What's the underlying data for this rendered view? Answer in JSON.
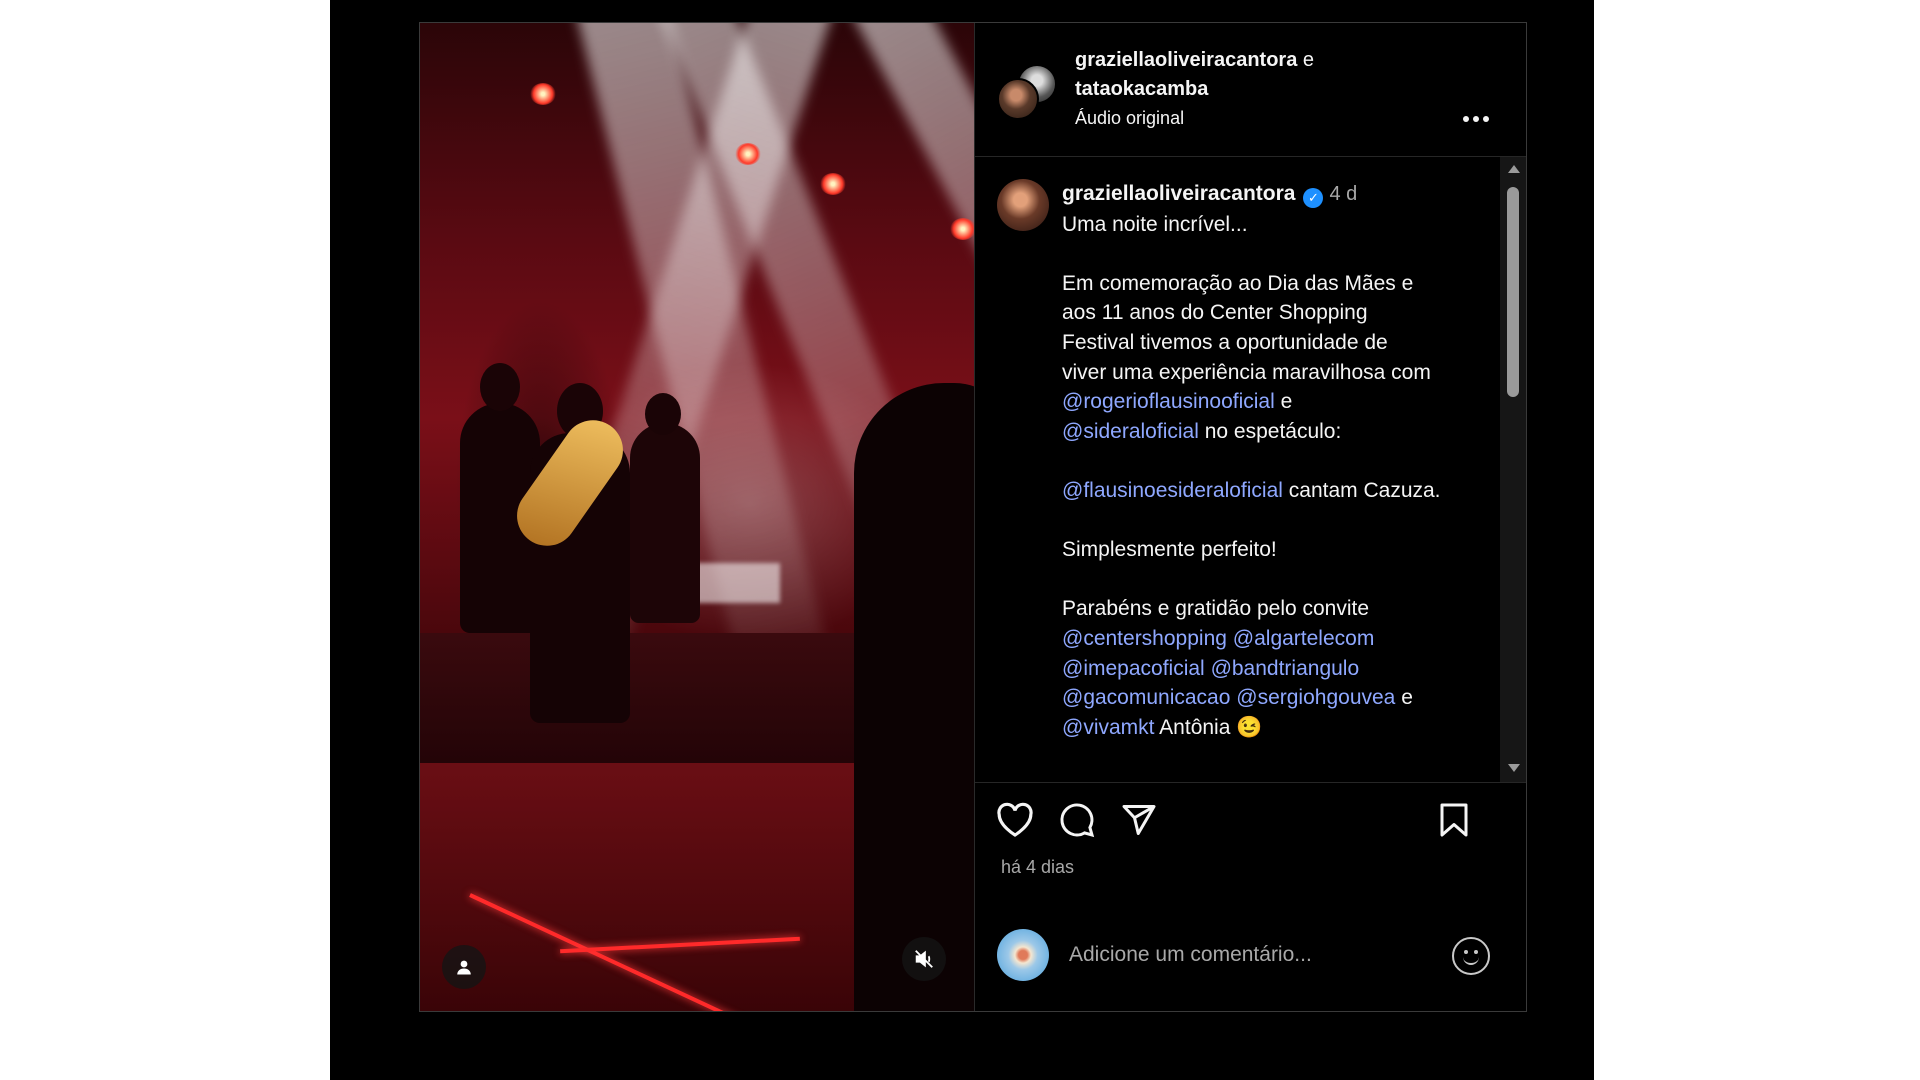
{
  "header": {
    "user1": "graziellaoliveiracantora",
    "conjunction": "e",
    "user2": "tataokacamba",
    "audio": "Áudio original",
    "more_icon": "more-horizontal-icon"
  },
  "caption": {
    "username": "graziellaoliveiracantora",
    "verified_icon": "verified-badge-icon",
    "time": "4 d",
    "line1": "Uma noite incrível...",
    "p2_a": "Em comemoração ao Dia das Mães e",
    "p2_b": "aos 11 anos do Center Shopping",
    "p2_c": "Festival tivemos a oportunidade de",
    "p2_d": "viver uma experiência maravilhosa com",
    "m1": "@rogerioflausinooficial",
    "and1": " e",
    "m2": "@sideraloficial",
    "p2_e": " no espetáculo:",
    "m3": "@flausinoesideraloficial",
    "p3": " cantam Cazuza.",
    "p4": "Simplesmente perfeito!",
    "p5": "Parabéns e gratidão pelo convite",
    "m4": "@centershopping",
    "m5": "@algartelecom",
    "m6": "@imepacoficial",
    "m7": "@bandtriangulo",
    "m8": "@gacomunicacao",
    "m9": "@sergiohgouvea",
    "and2": " e",
    "m10": "@vivamkt",
    "p6": " Antônia 😉"
  },
  "actions": {
    "like_icon": "heart-icon",
    "comment_icon": "comment-icon",
    "share_icon": "send-icon",
    "save_icon": "bookmark-icon",
    "time_ago": "há 4 dias"
  },
  "comment": {
    "placeholder": "Adicione um comentário...",
    "emoji_icon": "emoji-icon"
  },
  "media": {
    "tag_icon": "user-tag-icon",
    "mute_icon": "muted-speaker-icon"
  },
  "colors": {
    "mention": "#8fa8ff",
    "verified": "#1e90ff",
    "background": "#000000"
  }
}
